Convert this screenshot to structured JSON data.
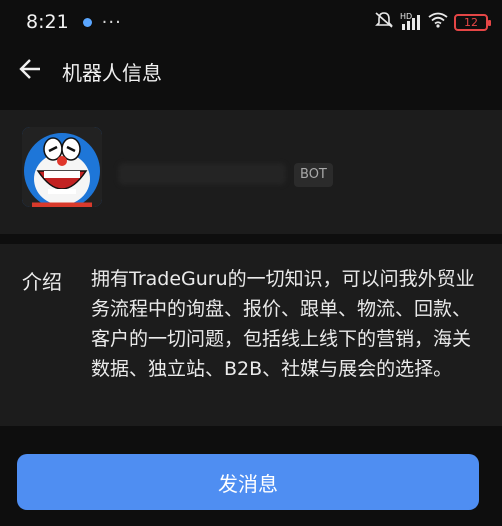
{
  "status_bar": {
    "time": "8:21",
    "more": "···",
    "net_label": "HD",
    "battery": "12",
    "icons": [
      "mute-icon",
      "signal-icon",
      "wifi-icon",
      "battery-icon"
    ]
  },
  "nav": {
    "title": "机器人信息",
    "back_icon": "arrow-left-icon"
  },
  "bot": {
    "badge": "BOT",
    "avatar_icon": "doraemon-avatar"
  },
  "intro": {
    "label": "介绍",
    "text": "拥有TradeGuru的一切知识，可以问我外贸业务流程中的询盘、报价、跟单、物流、回款、客户的一切问题，包括线上线下的营销，海关数据、独立站、B2B、社媒与展会的选择。"
  },
  "action": {
    "send_label": "发消息"
  },
  "colors": {
    "accent": "#4f8ef2",
    "card": "#1c1c1c",
    "background": "#0e0e0e",
    "battery_low": "#e54646"
  }
}
